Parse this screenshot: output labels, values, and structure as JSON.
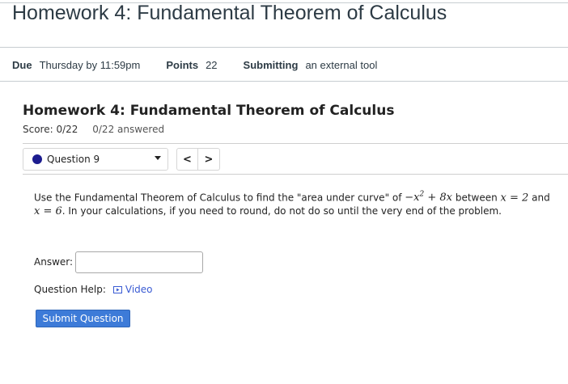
{
  "page": {
    "title": "Homework 4: Fundamental Theorem of Calculus"
  },
  "details": {
    "due_label": "Due",
    "due_value": "Thursday by 11:59pm",
    "points_label": "Points",
    "points_value": "22",
    "submitting_label": "Submitting",
    "submitting_value": "an external tool"
  },
  "homework": {
    "title": "Homework 4: Fundamental Theorem of Calculus",
    "score": "Score: 0/22",
    "answered": "0/22 answered"
  },
  "question_nav": {
    "selected": "Question 9",
    "prev_label": "<",
    "next_label": ">",
    "status_color": "#1c1c8f"
  },
  "question": {
    "text_1": "Use the Fundamental Theorem of Calculus to find the \"area under curve\" of ",
    "expr": "−x",
    "expr_exp": "2",
    "expr_rest": " + 8x",
    "text_2": " between ",
    "bound_1": "x = 2",
    "text_3": " and ",
    "bound_2": "x = 6",
    "text_4": ". In your calculations, if you need to round, do not do so until the very end of the problem."
  },
  "answer": {
    "label": "Answer:",
    "value": ""
  },
  "help": {
    "label": "Question Help:",
    "video_label": "Video",
    "video_icon": "play-video-icon"
  },
  "submit": {
    "label": "Submit Question",
    "color": "#3d7bd8"
  }
}
